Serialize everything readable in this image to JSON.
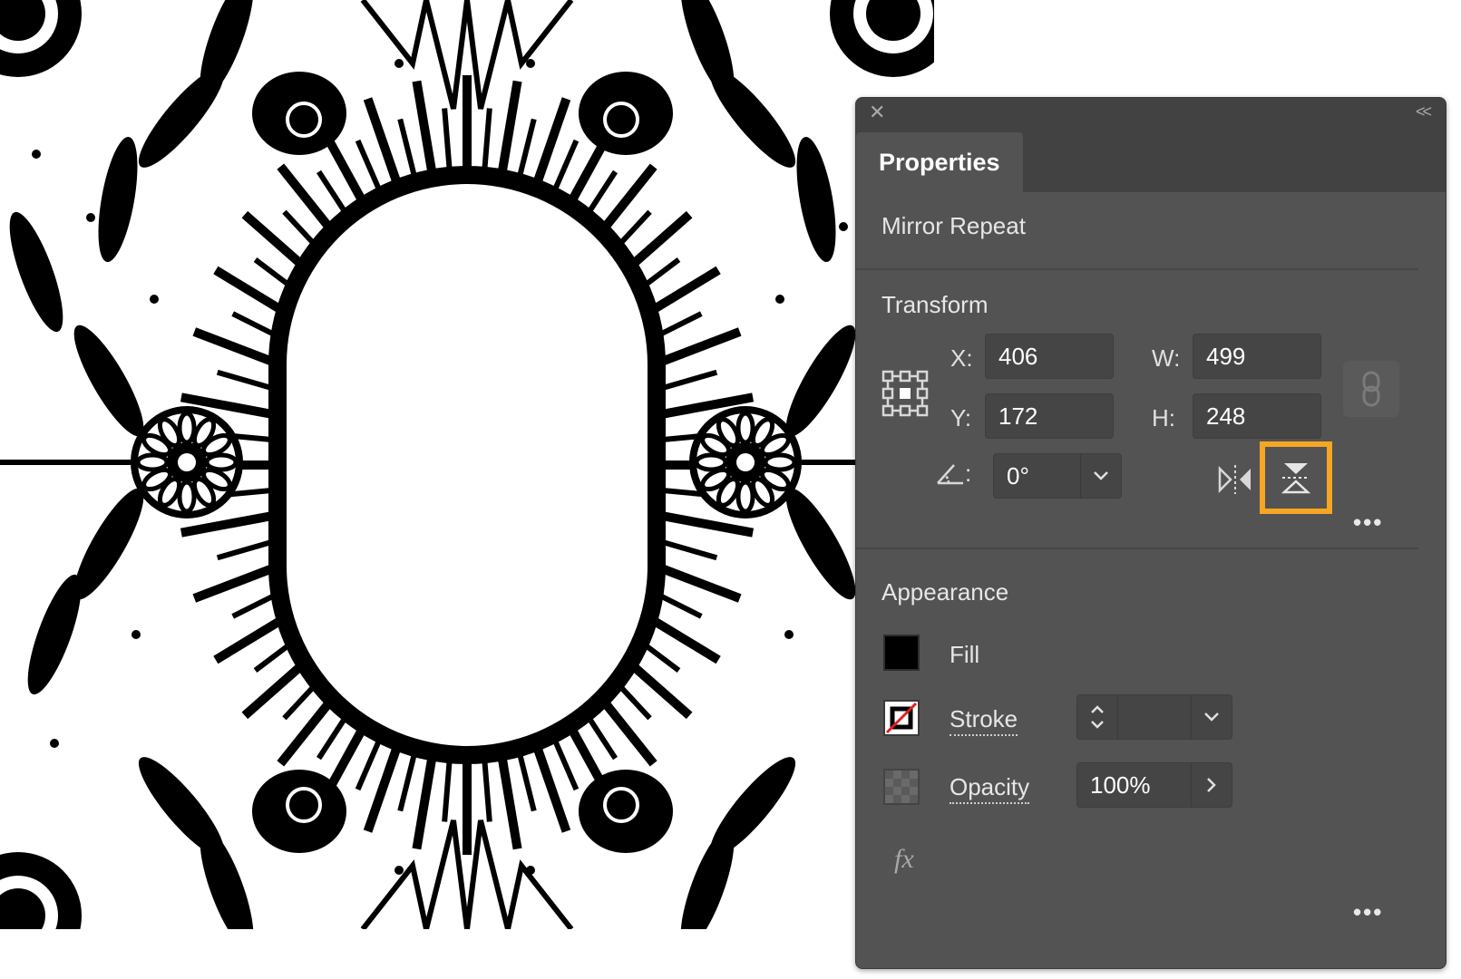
{
  "panel": {
    "tab_label": "Properties",
    "context_title": "Mirror Repeat",
    "close_glyph": "✕",
    "collapse_glyph": "<<"
  },
  "transform": {
    "title": "Transform",
    "x_label": "X:",
    "x_value": "406",
    "y_label": "Y:",
    "y_value": "172",
    "w_label": "W:",
    "w_value": "499",
    "h_label": "H:",
    "h_value": "248",
    "angle_label": ":",
    "angle_value": "0°",
    "icons": [
      "reference-point-icon",
      "constrain-link-icon",
      "flip-horizontal-icon",
      "flip-vertical-icon",
      "angle-icon"
    ],
    "highlight_color": "#f5a623"
  },
  "appearance": {
    "title": "Appearance",
    "fill_label": "Fill",
    "fill_color": "#000000",
    "stroke_label": "Stroke",
    "stroke_value": "",
    "opacity_label": "Opacity",
    "opacity_value": "100%",
    "fx_label": "fx"
  },
  "more_glyph": "•••"
}
